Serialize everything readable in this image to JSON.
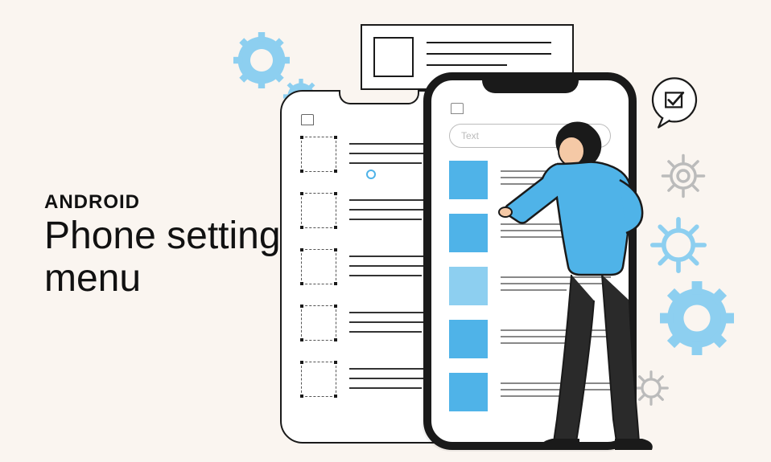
{
  "headline": {
    "kicker": "ANDROID",
    "title_line1": "Phone settings",
    "title_line2": "menu"
  },
  "phone": {
    "search_placeholder": "Text",
    "menu_items": [
      {
        "color": "#4fb3e8"
      },
      {
        "color": "#4fb3e8"
      },
      {
        "color": "#8dcff0"
      },
      {
        "color": "#4fb3e8"
      },
      {
        "color": "#4fb3e8"
      }
    ]
  },
  "colors": {
    "accent_blue": "#4fb3e8",
    "light_blue": "#8dcff0",
    "dark": "#1a1a1a",
    "bg": "#faf5f0"
  }
}
